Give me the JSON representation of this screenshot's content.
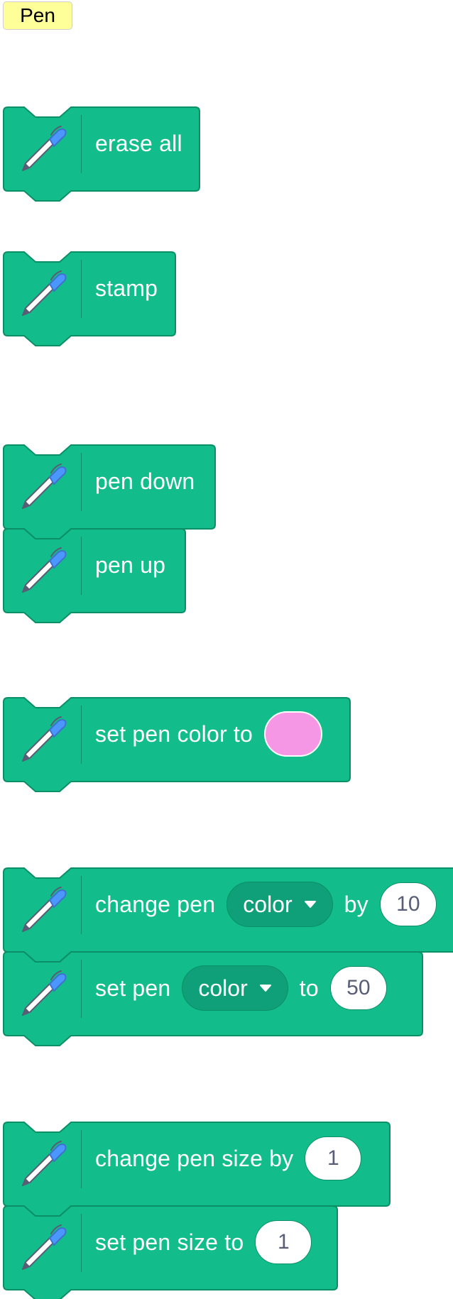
{
  "category": {
    "label": "Pen"
  },
  "colors": {
    "block_fill": "#12bd8b",
    "block_stroke": "#0b8f66",
    "category_bg": "#ffff99",
    "pen_color_swatch": "#f597e5"
  },
  "icon": "pen-icon",
  "blocks": {
    "erase_all": {
      "label": "erase all"
    },
    "stamp": {
      "label": "stamp"
    },
    "pen_down": {
      "label": "pen down"
    },
    "pen_up": {
      "label": "pen up"
    },
    "set_pen_color": {
      "label": "set pen color to"
    },
    "change_pen_param": {
      "prefix": "change pen",
      "param": "color",
      "mid": "by",
      "value": "10"
    },
    "set_pen_param": {
      "prefix": "set pen",
      "param": "color",
      "mid": "to",
      "value": "50"
    },
    "change_pen_size": {
      "label": "change pen size by",
      "value": "1"
    },
    "set_pen_size": {
      "label": "set pen size to",
      "value": "1"
    }
  }
}
